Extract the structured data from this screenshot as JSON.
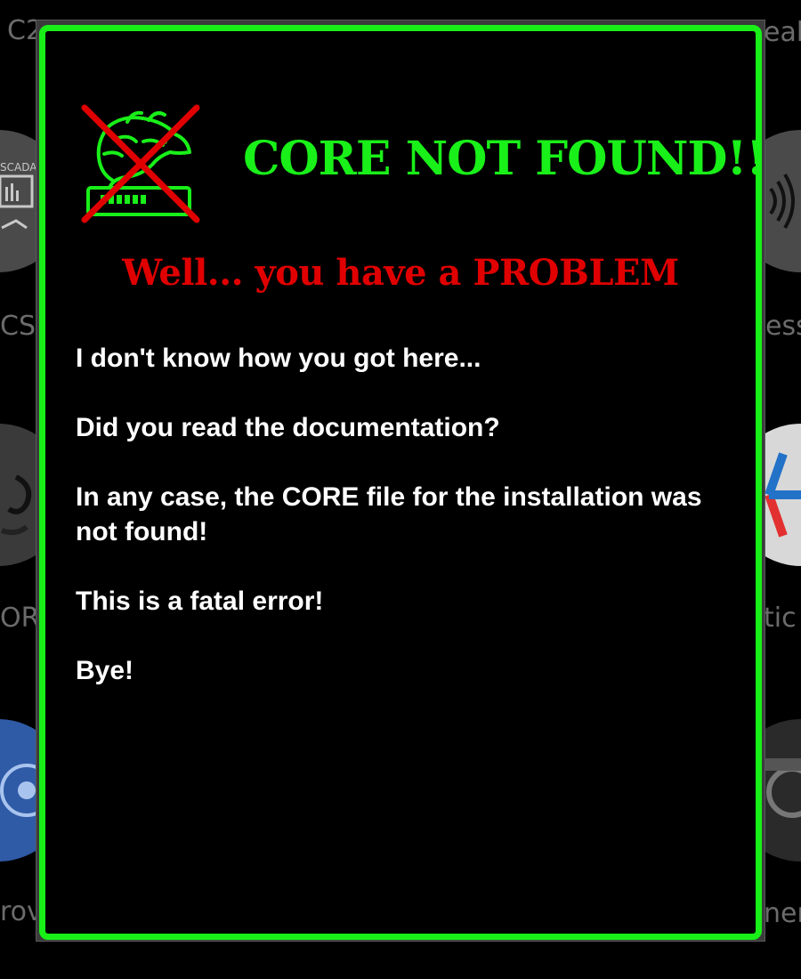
{
  "background": {
    "labels": {
      "top_left": "C2",
      "top_right": "eak",
      "mid_left_1": "CS/",
      "mid_right_1": "ess",
      "mid_left_2": "OR",
      "mid_right_2": "tic",
      "bottom_left": "rov",
      "bottom_right": "nera"
    },
    "icons": {
      "left_1_label": "SCADA"
    }
  },
  "dialog": {
    "title": "CORE NOT FOUND!!!",
    "subtitle": "Well... you have a PROBLEM",
    "logo_icon": "crossed-out-dragon-icon",
    "paragraphs": [
      "I don't know how you got here...",
      "Did you read the documentation?",
      "In any case, the CORE file for the installation was not found!",
      "This is a fatal error!",
      "Bye!"
    ]
  },
  "colors": {
    "border": "#18f018",
    "title": "#19f019",
    "subtitle": "#e00000",
    "body_text": "#ffffff",
    "background": "#000000"
  }
}
